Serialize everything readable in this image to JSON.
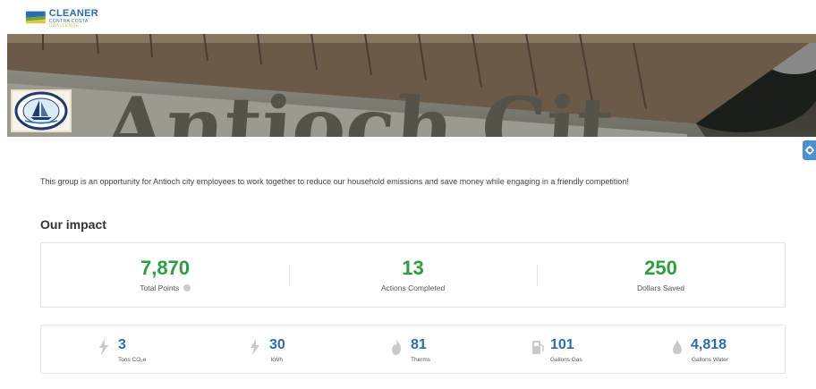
{
  "brand": {
    "name": "CLEANER",
    "sub": "CONTRA COSTA",
    "tag": "CHALLENGE"
  },
  "banner": {
    "sign_text": "Antioch Cit",
    "seal_top": "CITY OF ANTIOCH",
    "seal_bottom": "CALIFORNIA"
  },
  "description": "This group is an opportunity for Antioch city employees to work together to reduce our household emissions and save money while engaging in a friendly competition!",
  "impact": {
    "title": "Our impact",
    "stats": [
      {
        "value": "7,870",
        "label": "Total Points"
      },
      {
        "value": "13",
        "label": "Actions Completed"
      },
      {
        "value": "250",
        "label": "Dollars Saved"
      }
    ],
    "metrics": [
      {
        "value": "3",
        "label": "Tons CO₂e",
        "icon": "lightning-icon"
      },
      {
        "value": "30",
        "label": "kWh",
        "icon": "lightning-icon"
      },
      {
        "value": "81",
        "label": "Therms",
        "icon": "flame-icon"
      },
      {
        "value": "101",
        "label": "Gallons Gas",
        "icon": "gas-pump-icon"
      },
      {
        "value": "4,818",
        "label": "Gallons Water",
        "icon": "water-drop-icon"
      }
    ]
  },
  "colors": {
    "green": "#2e9d3f",
    "blue": "#2c6cae",
    "accent_button": "#4e8fd1"
  }
}
